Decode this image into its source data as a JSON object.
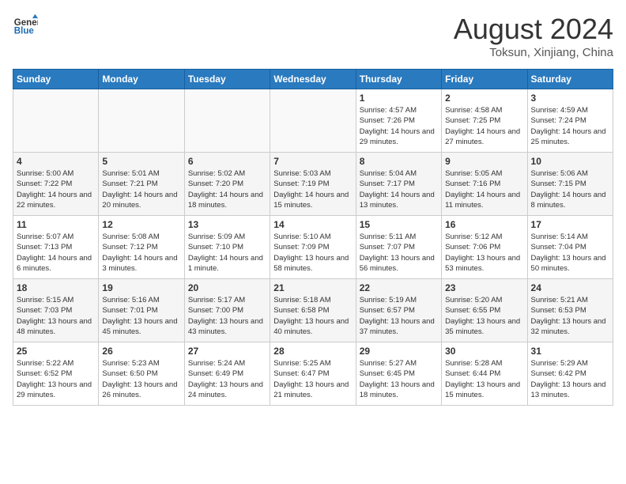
{
  "logo": {
    "line1": "General",
    "line2": "Blue"
  },
  "title": "August 2024",
  "location": "Toksun, Xinjiang, China",
  "weekdays": [
    "Sunday",
    "Monday",
    "Tuesday",
    "Wednesday",
    "Thursday",
    "Friday",
    "Saturday"
  ],
  "weeks": [
    [
      {
        "day": "",
        "sunrise": "",
        "sunset": "",
        "daylight": ""
      },
      {
        "day": "",
        "sunrise": "",
        "sunset": "",
        "daylight": ""
      },
      {
        "day": "",
        "sunrise": "",
        "sunset": "",
        "daylight": ""
      },
      {
        "day": "",
        "sunrise": "",
        "sunset": "",
        "daylight": ""
      },
      {
        "day": "1",
        "sunrise": "Sunrise: 4:57 AM",
        "sunset": "Sunset: 7:26 PM",
        "daylight": "Daylight: 14 hours and 29 minutes."
      },
      {
        "day": "2",
        "sunrise": "Sunrise: 4:58 AM",
        "sunset": "Sunset: 7:25 PM",
        "daylight": "Daylight: 14 hours and 27 minutes."
      },
      {
        "day": "3",
        "sunrise": "Sunrise: 4:59 AM",
        "sunset": "Sunset: 7:24 PM",
        "daylight": "Daylight: 14 hours and 25 minutes."
      }
    ],
    [
      {
        "day": "4",
        "sunrise": "Sunrise: 5:00 AM",
        "sunset": "Sunset: 7:22 PM",
        "daylight": "Daylight: 14 hours and 22 minutes."
      },
      {
        "day": "5",
        "sunrise": "Sunrise: 5:01 AM",
        "sunset": "Sunset: 7:21 PM",
        "daylight": "Daylight: 14 hours and 20 minutes."
      },
      {
        "day": "6",
        "sunrise": "Sunrise: 5:02 AM",
        "sunset": "Sunset: 7:20 PM",
        "daylight": "Daylight: 14 hours and 18 minutes."
      },
      {
        "day": "7",
        "sunrise": "Sunrise: 5:03 AM",
        "sunset": "Sunset: 7:19 PM",
        "daylight": "Daylight: 14 hours and 15 minutes."
      },
      {
        "day": "8",
        "sunrise": "Sunrise: 5:04 AM",
        "sunset": "Sunset: 7:17 PM",
        "daylight": "Daylight: 14 hours and 13 minutes."
      },
      {
        "day": "9",
        "sunrise": "Sunrise: 5:05 AM",
        "sunset": "Sunset: 7:16 PM",
        "daylight": "Daylight: 14 hours and 11 minutes."
      },
      {
        "day": "10",
        "sunrise": "Sunrise: 5:06 AM",
        "sunset": "Sunset: 7:15 PM",
        "daylight": "Daylight: 14 hours and 8 minutes."
      }
    ],
    [
      {
        "day": "11",
        "sunrise": "Sunrise: 5:07 AM",
        "sunset": "Sunset: 7:13 PM",
        "daylight": "Daylight: 14 hours and 6 minutes."
      },
      {
        "day": "12",
        "sunrise": "Sunrise: 5:08 AM",
        "sunset": "Sunset: 7:12 PM",
        "daylight": "Daylight: 14 hours and 3 minutes."
      },
      {
        "day": "13",
        "sunrise": "Sunrise: 5:09 AM",
        "sunset": "Sunset: 7:10 PM",
        "daylight": "Daylight: 14 hours and 1 minute."
      },
      {
        "day": "14",
        "sunrise": "Sunrise: 5:10 AM",
        "sunset": "Sunset: 7:09 PM",
        "daylight": "Daylight: 13 hours and 58 minutes."
      },
      {
        "day": "15",
        "sunrise": "Sunrise: 5:11 AM",
        "sunset": "Sunset: 7:07 PM",
        "daylight": "Daylight: 13 hours and 56 minutes."
      },
      {
        "day": "16",
        "sunrise": "Sunrise: 5:12 AM",
        "sunset": "Sunset: 7:06 PM",
        "daylight": "Daylight: 13 hours and 53 minutes."
      },
      {
        "day": "17",
        "sunrise": "Sunrise: 5:14 AM",
        "sunset": "Sunset: 7:04 PM",
        "daylight": "Daylight: 13 hours and 50 minutes."
      }
    ],
    [
      {
        "day": "18",
        "sunrise": "Sunrise: 5:15 AM",
        "sunset": "Sunset: 7:03 PM",
        "daylight": "Daylight: 13 hours and 48 minutes."
      },
      {
        "day": "19",
        "sunrise": "Sunrise: 5:16 AM",
        "sunset": "Sunset: 7:01 PM",
        "daylight": "Daylight: 13 hours and 45 minutes."
      },
      {
        "day": "20",
        "sunrise": "Sunrise: 5:17 AM",
        "sunset": "Sunset: 7:00 PM",
        "daylight": "Daylight: 13 hours and 43 minutes."
      },
      {
        "day": "21",
        "sunrise": "Sunrise: 5:18 AM",
        "sunset": "Sunset: 6:58 PM",
        "daylight": "Daylight: 13 hours and 40 minutes."
      },
      {
        "day": "22",
        "sunrise": "Sunrise: 5:19 AM",
        "sunset": "Sunset: 6:57 PM",
        "daylight": "Daylight: 13 hours and 37 minutes."
      },
      {
        "day": "23",
        "sunrise": "Sunrise: 5:20 AM",
        "sunset": "Sunset: 6:55 PM",
        "daylight": "Daylight: 13 hours and 35 minutes."
      },
      {
        "day": "24",
        "sunrise": "Sunrise: 5:21 AM",
        "sunset": "Sunset: 6:53 PM",
        "daylight": "Daylight: 13 hours and 32 minutes."
      }
    ],
    [
      {
        "day": "25",
        "sunrise": "Sunrise: 5:22 AM",
        "sunset": "Sunset: 6:52 PM",
        "daylight": "Daylight: 13 hours and 29 minutes."
      },
      {
        "day": "26",
        "sunrise": "Sunrise: 5:23 AM",
        "sunset": "Sunset: 6:50 PM",
        "daylight": "Daylight: 13 hours and 26 minutes."
      },
      {
        "day": "27",
        "sunrise": "Sunrise: 5:24 AM",
        "sunset": "Sunset: 6:49 PM",
        "daylight": "Daylight: 13 hours and 24 minutes."
      },
      {
        "day": "28",
        "sunrise": "Sunrise: 5:25 AM",
        "sunset": "Sunset: 6:47 PM",
        "daylight": "Daylight: 13 hours and 21 minutes."
      },
      {
        "day": "29",
        "sunrise": "Sunrise: 5:27 AM",
        "sunset": "Sunset: 6:45 PM",
        "daylight": "Daylight: 13 hours and 18 minutes."
      },
      {
        "day": "30",
        "sunrise": "Sunrise: 5:28 AM",
        "sunset": "Sunset: 6:44 PM",
        "daylight": "Daylight: 13 hours and 15 minutes."
      },
      {
        "day": "31",
        "sunrise": "Sunrise: 5:29 AM",
        "sunset": "Sunset: 6:42 PM",
        "daylight": "Daylight: 13 hours and 13 minutes."
      }
    ]
  ]
}
